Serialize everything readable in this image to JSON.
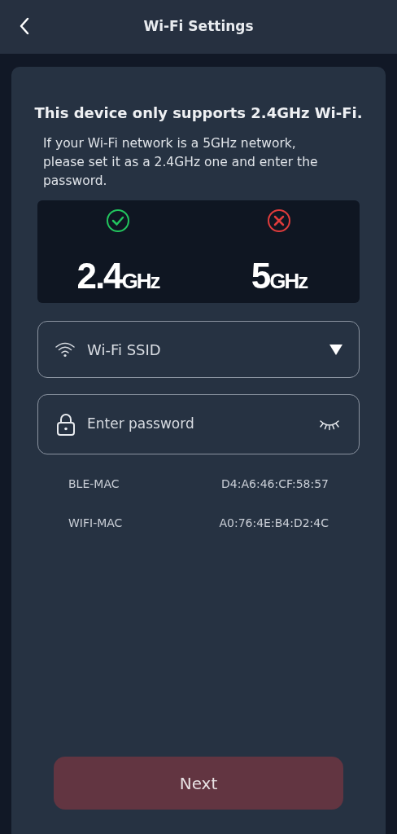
{
  "header": {
    "title": "Wi-Fi Settings"
  },
  "card": {
    "title": "This device only supports 2.4GHz Wi-Fi.",
    "description": "If your Wi-Fi network is a 5GHz network, please set it as a 2.4GHz one and enter the password.",
    "bands": [
      {
        "number": "2.4",
        "unit": "GHz",
        "supported": true
      },
      {
        "number": "5",
        "unit": "GHz",
        "supported": false
      }
    ],
    "ssid_field": {
      "placeholder": "Wi-Fi SSID"
    },
    "password_field": {
      "placeholder": "Enter password"
    },
    "info_rows": [
      {
        "label": "BLE-MAC",
        "value": "D4:A6:46:CF:58:57"
      },
      {
        "label": "WIFI-MAC",
        "value": "A0:76:4E:B4:D2:4C"
      }
    ],
    "next_button": "Next"
  }
}
